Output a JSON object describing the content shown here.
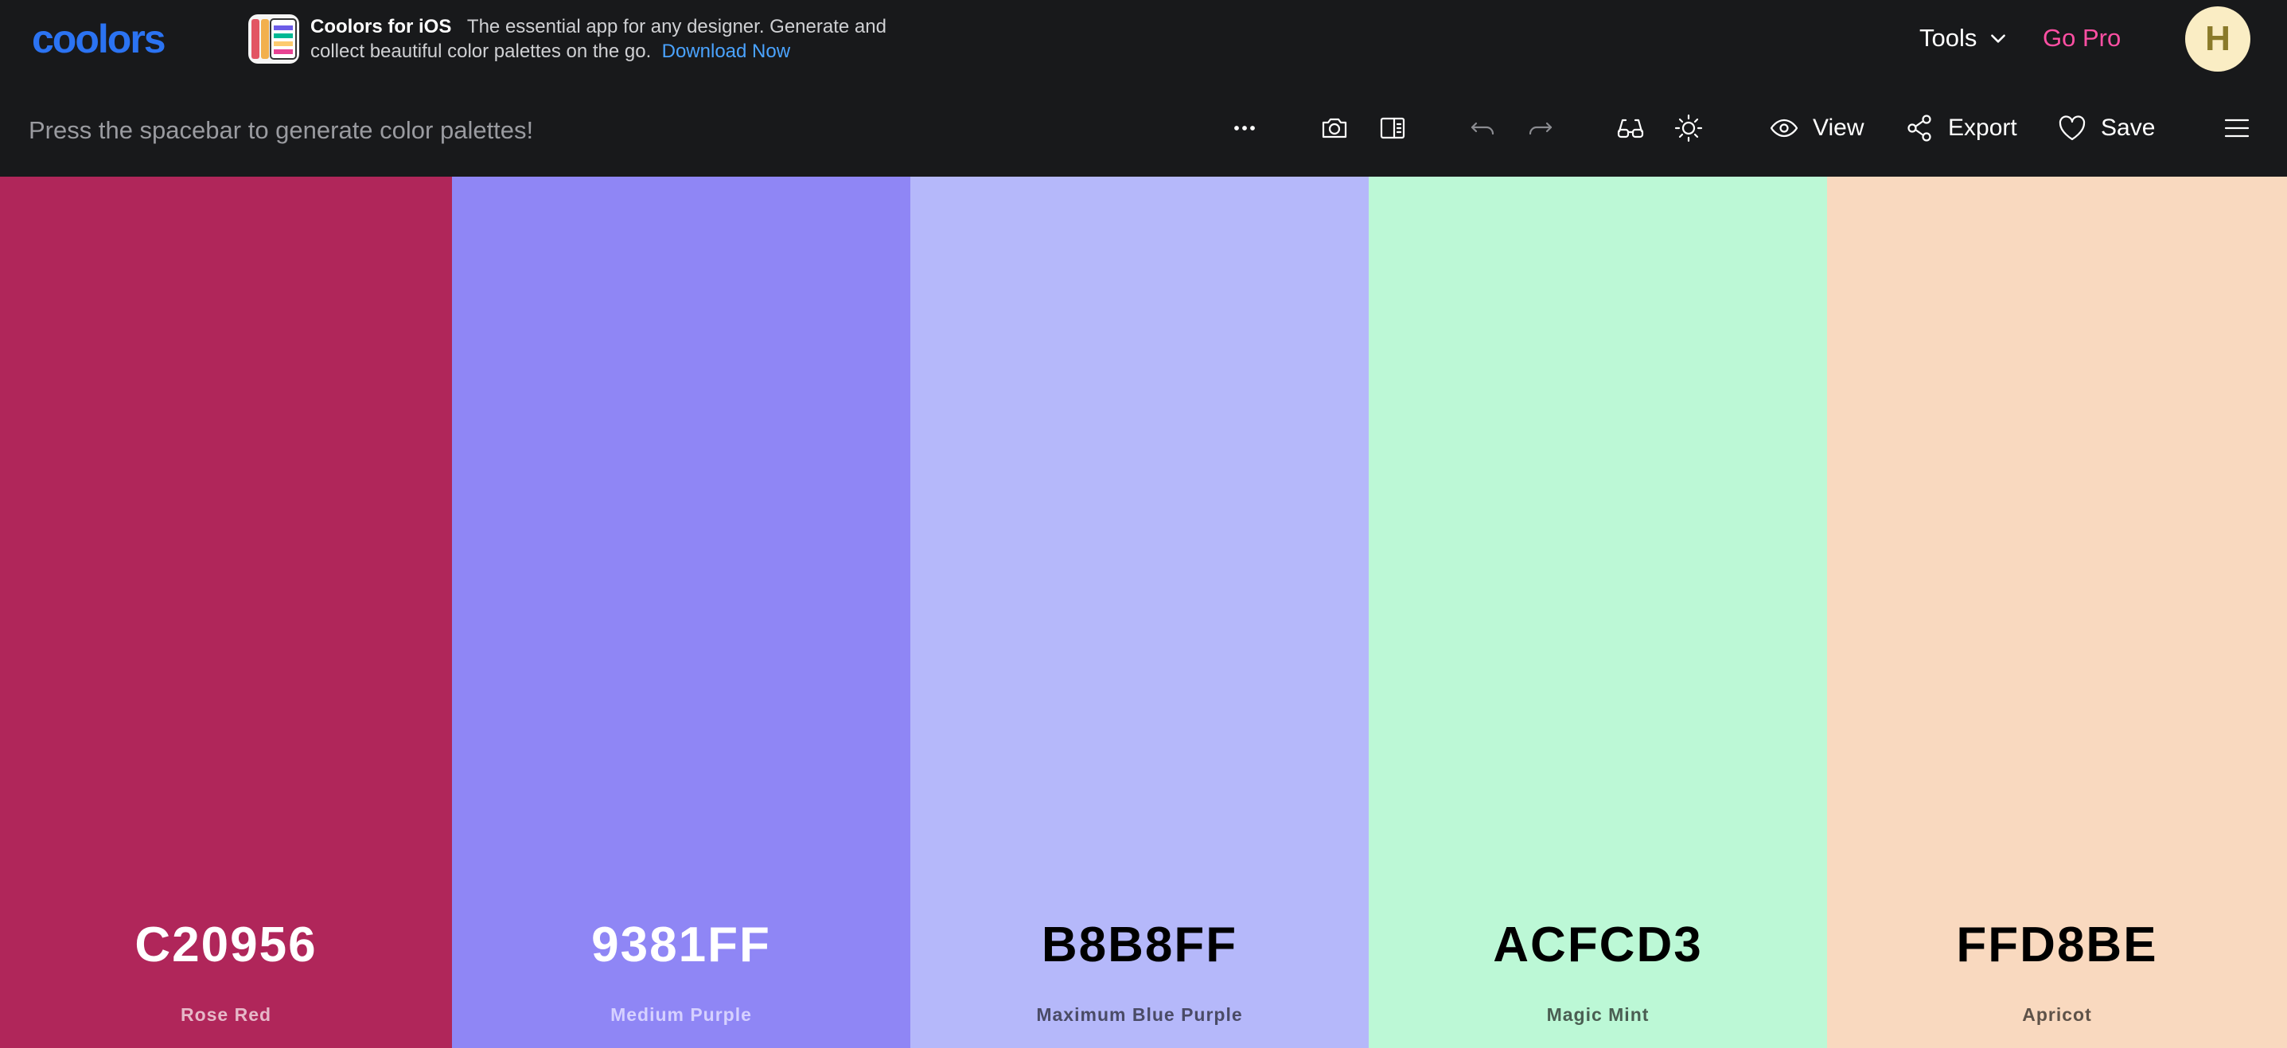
{
  "header": {
    "logo_text": "coolors",
    "promo": {
      "title": "Coolors for iOS",
      "text": "The essential app for any designer. Generate and collect beautiful color palettes on the go.",
      "link": "Download Now"
    },
    "tools_label": "Tools",
    "gopro_label": "Go Pro",
    "avatar_letter": "H"
  },
  "toolbar": {
    "hint": "Press the spacebar to generate color palettes!",
    "icons": [
      "more-icon",
      "camera-icon",
      "sidebar-icon",
      "undo-icon",
      "redo-icon",
      "glasses-icon",
      "sun-icon"
    ],
    "view_label": "View",
    "export_label": "Export",
    "save_label": "Save"
  },
  "palette": [
    {
      "hex": "C20956",
      "name": "Rose Red",
      "color": "#b0265a",
      "text_color": "#ffffff",
      "name_color": "#e6b8c8"
    },
    {
      "hex": "9381FF",
      "name": "Medium Purple",
      "color": "#8f86f5",
      "text_color": "#ffffff",
      "name_color": "#d6d1ff"
    },
    {
      "hex": "B8B8FF",
      "name": "Maximum Blue Purple",
      "color": "#b5b8fa",
      "text_color": "#000000",
      "name_color": "#4a4b66"
    },
    {
      "hex": "ACFCD3",
      "name": "Magic Mint",
      "color": "#bcf8d6",
      "text_color": "#000000",
      "name_color": "#4a5e52"
    },
    {
      "hex": "FFD8BE",
      "name": "Apricot",
      "color": "#f9d9bf",
      "text_color": "#000000",
      "name_color": "#5e5248"
    }
  ]
}
